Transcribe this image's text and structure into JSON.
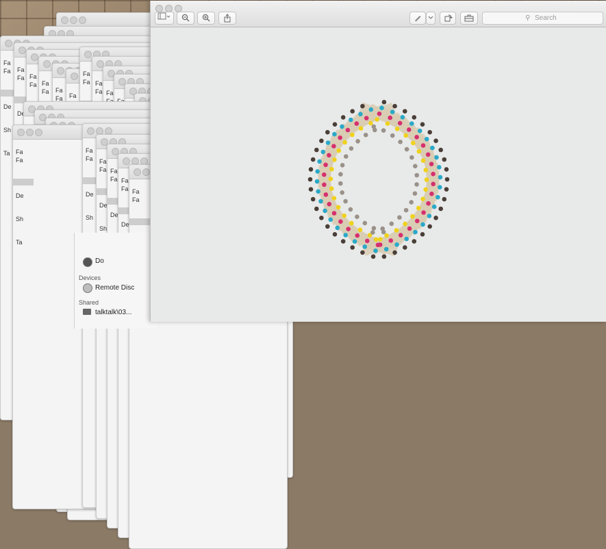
{
  "preview": {
    "toolbar": {
      "sidebar_icon": "sidebar-toggle-icon",
      "zoom_out_icon": "zoom-out-icon",
      "zoom_in_icon": "zoom-in-icon",
      "share_icon": "share-icon",
      "markup_icon": "pen-markup-icon",
      "rotate_icon": "rotate-icon",
      "toolbox_icon": "toolbox-icon",
      "search_placeholder": "Search"
    }
  },
  "finder": {
    "partial_item": "Do",
    "devices_label": "Devices",
    "remote_disc": "Remote Disc",
    "shared_label": "Shared",
    "shared_item": "talktalk\\03..."
  },
  "background_windows": {
    "row_labels": [
      "Fa",
      "De",
      "Sh",
      "Ta"
    ]
  },
  "colors": {
    "dot_black": "#4a3f38",
    "dot_cyan": "#2aa9c9",
    "dot_magenta": "#d6306e",
    "dot_yellow": "#f0d21c",
    "dot_grey": "#9a928a",
    "tape": "#d8ccb4"
  }
}
